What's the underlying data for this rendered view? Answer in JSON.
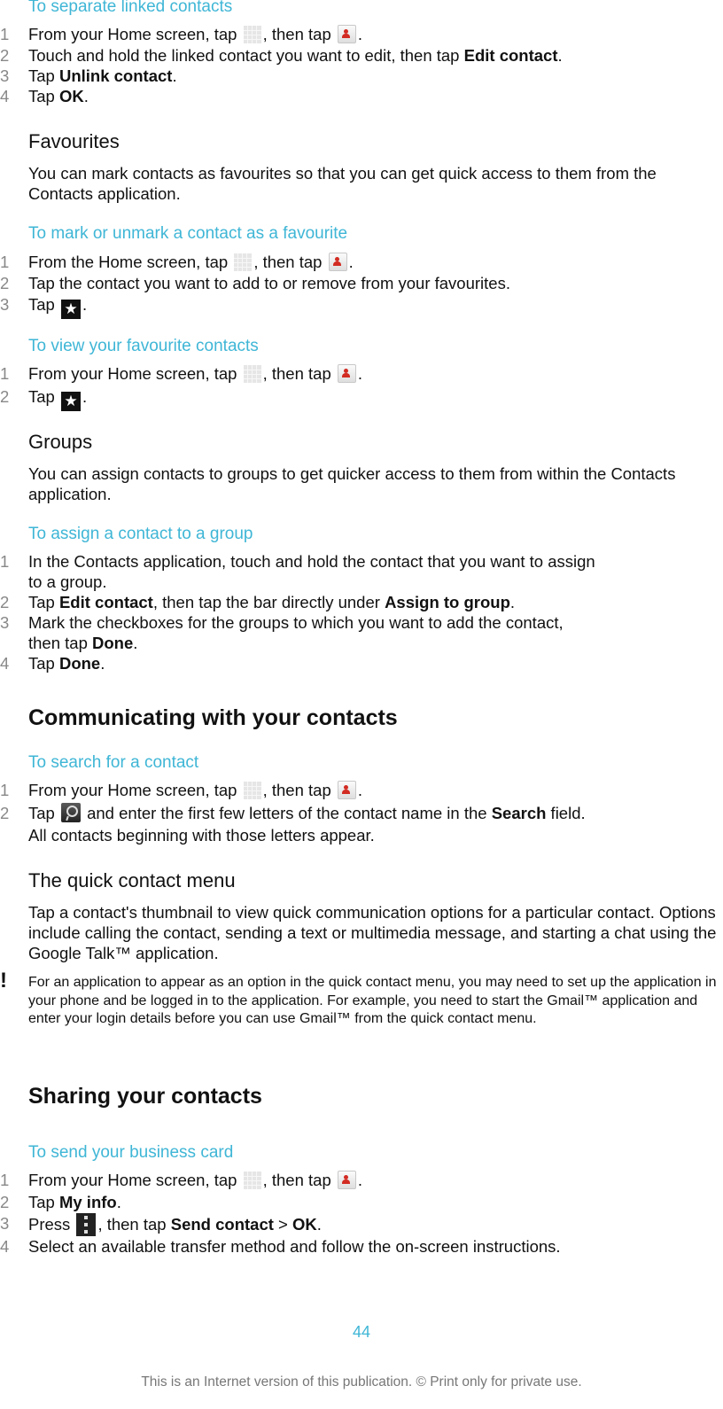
{
  "sections": {
    "separate": {
      "heading": "To separate linked contacts",
      "steps": [
        {
          "num": "1",
          "a": "From your Home screen, tap ",
          "b": ", then tap ",
          "c": "."
        },
        {
          "num": "2",
          "a": "Touch and hold the linked contact you want to edit, then tap ",
          "bold": "Edit contact",
          "c": "."
        },
        {
          "num": "3",
          "a": "Tap ",
          "bold": "Unlink contact",
          "c": "."
        },
        {
          "num": "4",
          "a": "Tap ",
          "bold": "OK",
          "c": "."
        }
      ]
    },
    "favourites": {
      "heading": "Favourites",
      "body": "You can mark contacts as favourites so that you can get quick access to them from the Contacts application."
    },
    "mark_favourite": {
      "heading": "To mark or unmark a contact as a favourite",
      "steps": [
        {
          "num": "1",
          "a": "From the Home screen, tap ",
          "b": ", then tap ",
          "c": "."
        },
        {
          "num": "2",
          "a": "Tap the contact you want to add to or remove from your favourites."
        },
        {
          "num": "3",
          "a": "Tap ",
          "c": "."
        }
      ]
    },
    "view_favourites": {
      "heading": "To view your favourite contacts",
      "steps": [
        {
          "num": "1",
          "a": "From your Home screen, tap ",
          "b": ", then tap ",
          "c": "."
        },
        {
          "num": "2",
          "a": "Tap ",
          "c": "."
        }
      ]
    },
    "groups": {
      "heading": "Groups",
      "body": "You can assign contacts to groups to get quicker access to them from within the Contacts application."
    },
    "assign_group": {
      "heading": "To assign a contact to a group",
      "steps": [
        {
          "num": "1",
          "a": "In the Contacts application, touch and hold the contact that you want to assign",
          "a2": "to a group."
        },
        {
          "num": "2",
          "a": "Tap ",
          "bold": "Edit contact",
          "b": ", then tap the bar directly under ",
          "bold2": "Assign to group",
          "c": "."
        },
        {
          "num": "3",
          "a": "Mark the checkboxes for the groups to which you want to add the contact,",
          "a2": "then tap ",
          "bold": "Done",
          "c": "."
        },
        {
          "num": "4",
          "a": "Tap ",
          "bold": "Done",
          "c": "."
        }
      ]
    },
    "communicating": {
      "heading": "Communicating with your contacts"
    },
    "search_contact": {
      "heading": "To search for a contact",
      "steps": [
        {
          "num": "1",
          "a": "From your Home screen, tap ",
          "b": ", then tap ",
          "c": "."
        },
        {
          "num": "2",
          "a": "Tap ",
          "b": " and enter the first few letters of the contact name in the ",
          "bold": "Search",
          "c": " field.",
          "a2": "All contacts beginning with those letters appear."
        }
      ]
    },
    "quick_menu": {
      "heading": "The quick contact menu",
      "body": "Tap a contact's thumbnail to view quick communication options for a particular contact. Options include calling the contact, sending a text or multimedia message, and starting a chat using the Google Talk™ application.",
      "note": "For an application to appear as an option in the quick contact menu, you may need to set up the application in your phone and be logged in to the application. For example, you need to start the Gmail™ application and enter your login details before you can use Gmail™ from the quick contact menu.",
      "note_icon": "!"
    },
    "sharing": {
      "heading": "Sharing your contacts"
    },
    "business_card": {
      "heading": "To send your business card",
      "steps": [
        {
          "num": "1",
          "a": "From your Home screen, tap ",
          "b": ", then tap ",
          "c": "."
        },
        {
          "num": "2",
          "a": "Tap ",
          "bold": "My info",
          "c": "."
        },
        {
          "num": "3",
          "a": "Press ",
          "b": ", then tap ",
          "bold": "Send contact",
          "mid": " > ",
          "bold2": "OK",
          "c": "."
        },
        {
          "num": "4",
          "a": "Select an available transfer method and follow the on-screen instructions."
        }
      ]
    }
  },
  "icons": {
    "apps": "apps-grid-icon",
    "contacts": "contacts-icon",
    "star": "★",
    "search": "search-icon",
    "menu": "menu-icon"
  },
  "page_number": "44",
  "footer": "This is an Internet version of this publication. © Print only for private use.",
  "colors": {
    "heading_accent": "#3fb6d6",
    "step_number": "#888888",
    "footer_text": "#777777"
  }
}
